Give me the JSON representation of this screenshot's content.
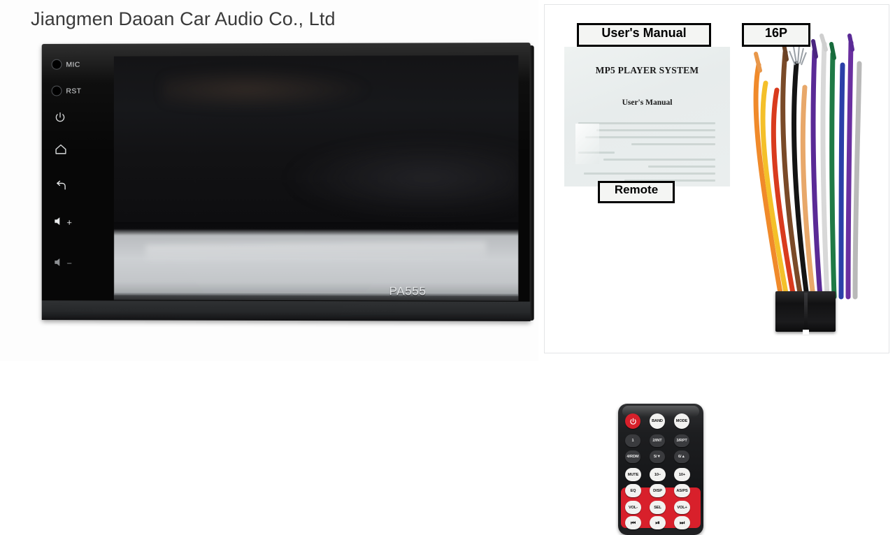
{
  "page": {
    "background_color": "#ffffff",
    "accent_red": "#d8202b"
  },
  "left_panel": {
    "company_title": "Jiangmen Daoan Car Audio Co., Ltd",
    "device": {
      "model_label": "PA555",
      "bezel_color": "#070707",
      "controls": [
        {
          "name": "mic",
          "label": "MIC",
          "icon": "microphone-hole-icon",
          "type": "hole"
        },
        {
          "name": "reset",
          "label": "RST",
          "icon": "reset-hole-icon",
          "type": "hole"
        },
        {
          "name": "power",
          "label": "",
          "icon": "power-icon",
          "glyph": "⏻",
          "type": "icon"
        },
        {
          "name": "home",
          "label": "",
          "icon": "home-icon",
          "glyph": "⌂",
          "type": "icon"
        },
        {
          "name": "back",
          "label": "",
          "icon": "back-arrow-icon",
          "glyph": "↩",
          "type": "icon"
        },
        {
          "name": "volume-up",
          "label": "+",
          "icon": "speaker-plus-icon",
          "glyph": "◁",
          "type": "icon"
        },
        {
          "name": "volume-down",
          "label": "−",
          "icon": "speaker-minus-icon",
          "glyph": "◁",
          "type": "icon"
        }
      ]
    }
  },
  "right_panel": {
    "captions": [
      {
        "name": "users-manual",
        "text": "User's Manual"
      },
      {
        "name": "sixteen-pin",
        "text": "16P"
      },
      {
        "name": "remote",
        "text": "Remote"
      }
    ],
    "manual": {
      "cover_title": "MP5 PLAYER SYSTEM",
      "cover_subtitle": "User's Manual"
    },
    "remote": {
      "body_color": "#1a1b1d",
      "keypad_accent": "#d8202b",
      "rows": [
        [
          {
            "name": "power",
            "label": "⏻",
            "style": "power"
          },
          {
            "name": "band",
            "label": "BAND",
            "style": "light"
          },
          {
            "name": "mode",
            "label": "MODE",
            "style": "light"
          }
        ],
        [
          {
            "name": "preset-1",
            "label": "1",
            "style": "dark"
          },
          {
            "name": "preset-2-int",
            "label": "2/INT",
            "style": "dark"
          },
          {
            "name": "preset-3-rpt",
            "label": "3/RPT",
            "style": "dark"
          }
        ],
        [
          {
            "name": "preset-4-rdm",
            "label": "4/RDM",
            "style": "dark"
          },
          {
            "name": "preset-5-folder-down",
            "label": "5/▼",
            "style": "dark"
          },
          {
            "name": "preset-6-folder-up",
            "label": "6/▲",
            "style": "dark"
          }
        ],
        [
          {
            "name": "mute",
            "label": "MUTE",
            "style": "light"
          },
          {
            "name": "ten-minus",
            "label": "10−",
            "style": "light"
          },
          {
            "name": "ten-plus",
            "label": "10+",
            "style": "light"
          }
        ],
        [
          {
            "name": "eq",
            "label": "EQ",
            "style": "light"
          },
          {
            "name": "disp",
            "label": "DISP",
            "style": "light"
          },
          {
            "name": "as-ps",
            "label": "AS/PS",
            "style": "light"
          }
        ],
        [
          {
            "name": "volume-down",
            "label": "VOL-",
            "style": "light"
          },
          {
            "name": "select",
            "label": "SEL",
            "style": "light"
          },
          {
            "name": "volume-up",
            "label": "VOL+",
            "style": "light"
          }
        ],
        [
          {
            "name": "previous-track",
            "label": "⏮",
            "style": "glyph"
          },
          {
            "name": "play-pause",
            "label": "⏯",
            "style": "glyph"
          },
          {
            "name": "next-track",
            "label": "⏭",
            "style": "glyph"
          }
        ]
      ]
    },
    "harness": {
      "connector_name": "16P connector",
      "wire_colors": [
        "#f08a2a",
        "#f4c02a",
        "#d93b1e",
        "#7a4a28",
        "#111111",
        "#c9c9c9",
        "#6a2fa0",
        "#1f7a46",
        "#2b3fa8",
        "#efefef",
        "#3a3a3a",
        "#b05a20"
      ]
    }
  }
}
